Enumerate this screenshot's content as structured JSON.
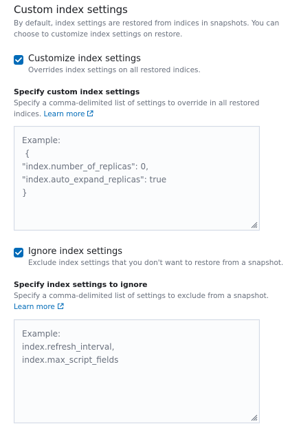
{
  "section": {
    "title": "Custom index settings",
    "description": "By default, index settings are restored from indices in snapshots. You can choose to customize index settings on restore."
  },
  "customize": {
    "checked": true,
    "label": "Customize index settings",
    "help": "Overrides index settings on all restored indices."
  },
  "custom_settings": {
    "label": "Specify custom index settings",
    "help": "Specify a comma-delimited list of settings to override in all restored indices.",
    "link": "Learn more",
    "placeholder_lines": [
      "Example:",
      " {",
      "\"index.number_of_replicas\": 0,",
      "\"index.auto_expand_replicas\": true",
      "}"
    ]
  },
  "ignore": {
    "checked": true,
    "label": "Ignore index settings",
    "help": "Exclude index settings that you don't want to restore from a snapshot."
  },
  "ignore_settings": {
    "label": "Specify index settings to ignore",
    "help": "Specify a comma-delimited list of settings to exclude from a snapshot.",
    "link": "Learn more",
    "placeholder_lines": [
      "Example:",
      "index.refresh_interval,",
      "index.max_script_fields"
    ]
  },
  "colors": {
    "accent": "#006bb8",
    "text": "#343741",
    "subdued": "#69707d",
    "border": "#d3dae6"
  }
}
